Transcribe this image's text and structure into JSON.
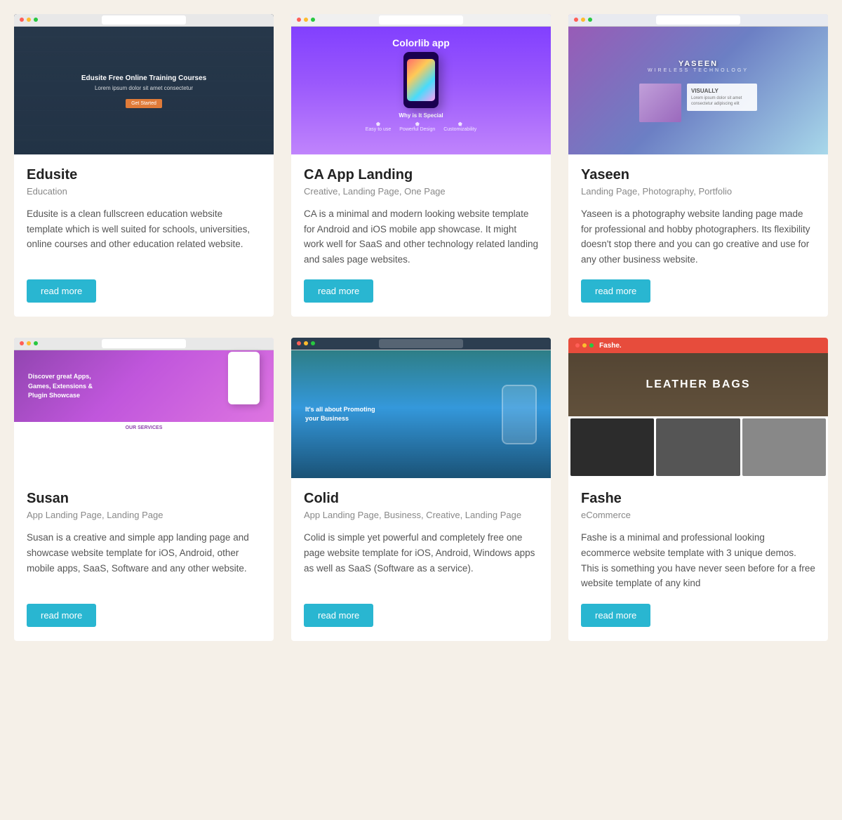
{
  "cards": [
    {
      "id": "edusite",
      "title": "Edusite",
      "tags": "Education",
      "description": "Edusite is a clean fullscreen education website template which is well suited for schools, universities, online courses and other education related website.",
      "read_more": "read more",
      "thumb_type": "edusite"
    },
    {
      "id": "ca-app-landing",
      "title": "CA App Landing",
      "tags": "Creative, Landing Page, One Page",
      "description": "CA is a minimal and modern looking website template for Android and iOS mobile app showcase. It might work well for SaaS and other technology related landing and sales page websites.",
      "read_more": "read more",
      "thumb_type": "ca"
    },
    {
      "id": "yaseen",
      "title": "Yaseen",
      "tags": "Landing Page, Photography, Portfolio",
      "description": "Yaseen is a photography website landing page made for professional and hobby photographers. Its flexibility doesn't stop there and you can go creative and use for any other business website.",
      "read_more": "read more",
      "thumb_type": "yaseen"
    },
    {
      "id": "susan",
      "title": "Susan",
      "tags": "App Landing Page, Landing Page",
      "description": "Susan is a creative and simple app landing page and showcase website template for iOS, Android, other mobile apps, SaaS, Software and any other website.",
      "read_more": "read more",
      "thumb_type": "susan"
    },
    {
      "id": "colid",
      "title": "Colid",
      "tags": "App Landing Page, Business, Creative, Landing Page",
      "description": "Colid is simple yet powerful and completely free one page website template for iOS, Android, Windows apps as well as SaaS (Software as a service).",
      "read_more": "read more",
      "thumb_type": "colid"
    },
    {
      "id": "fashe",
      "title": "Fashe",
      "tags": "eCommerce",
      "description": "Fashe is a minimal and professional looking ecommerce website template with 3 unique demos. This is something you have never seen before for a free website template of any kind",
      "read_more": "read more",
      "thumb_type": "fashe"
    }
  ],
  "ui": {
    "read_more_label": "read more"
  }
}
